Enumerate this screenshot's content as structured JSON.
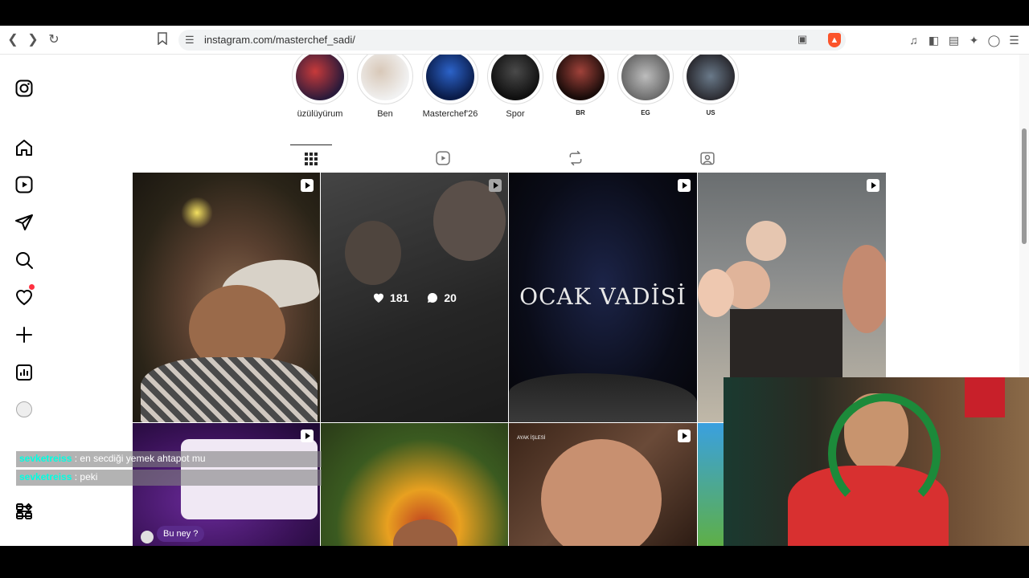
{
  "browser": {
    "url": "instagram.com/masterchef_sadi/"
  },
  "highlights": [
    {
      "label": "üzülüyürum"
    },
    {
      "label": "Ben"
    },
    {
      "label": "Masterchef'26"
    },
    {
      "label": "Spor"
    },
    {
      "label": "BR"
    },
    {
      "label": "EG"
    },
    {
      "label": "US"
    }
  ],
  "post_stats": {
    "likes": "181",
    "comments": "20"
  },
  "posts": {
    "ocak_title": "OCAK VADİSİ",
    "ayak_label": "AYAK İŞLESİ",
    "drawing_bubble": "Bu ney ?"
  },
  "chat": [
    {
      "user": "sevketreiss",
      "message": "en secdiği yemek ahtapot mu"
    },
    {
      "user": "sevketreiss",
      "message": "peki"
    }
  ],
  "colors": {
    "notif": "#ff3040",
    "chat_user": "#00ffe1",
    "brave": "#fb542b"
  }
}
